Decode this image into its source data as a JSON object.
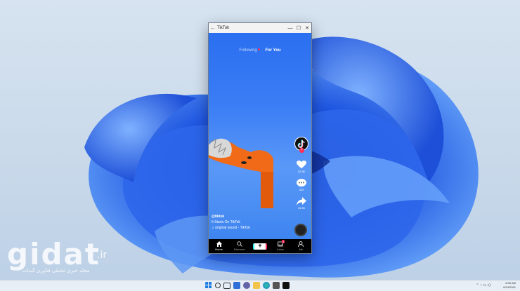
{
  "window": {
    "title": "TikTok",
    "back_glyph": "←",
    "minimize_glyph": "—",
    "maximize_glyph": "☐",
    "close_glyph": "✕"
  },
  "feed": {
    "following_label": "Following",
    "for_you_label": "For You"
  },
  "caption": {
    "username": "@tiktok",
    "description": "It Starts On TikTok",
    "sound": "original sound - TikTok"
  },
  "sidebar": {
    "avatar_icon": "tiktok-logo",
    "like_count": "32.5K",
    "comment_count": "329",
    "share_count": "15.5K"
  },
  "tabs": [
    {
      "label": "Home",
      "icon": "home-icon"
    },
    {
      "label": "Discover",
      "icon": "search-icon"
    },
    {
      "label": "",
      "icon": "create-icon"
    },
    {
      "label": "Inbox",
      "icon": "inbox-icon",
      "badge": "1"
    },
    {
      "label": "Me",
      "icon": "profile-icon"
    }
  ],
  "taskbar": {
    "icons": [
      "windows-start-icon",
      "search-icon",
      "task-view-icon",
      "widgets-icon",
      "teams-chat-icon",
      "file-explorer-icon",
      "edge-icon",
      "store-icon",
      "tiktok-icon"
    ],
    "time": "8:00 AM",
    "date": "6/24/2021"
  },
  "watermark": {
    "brand": "gidat",
    "tld": ".ir",
    "tagline": "مجله خبری تحلیلی فناوری گیدات"
  },
  "colors": {
    "accent": "#fe2c55",
    "cyan": "#25f4ee",
    "video_blue": "#3b7df5"
  }
}
